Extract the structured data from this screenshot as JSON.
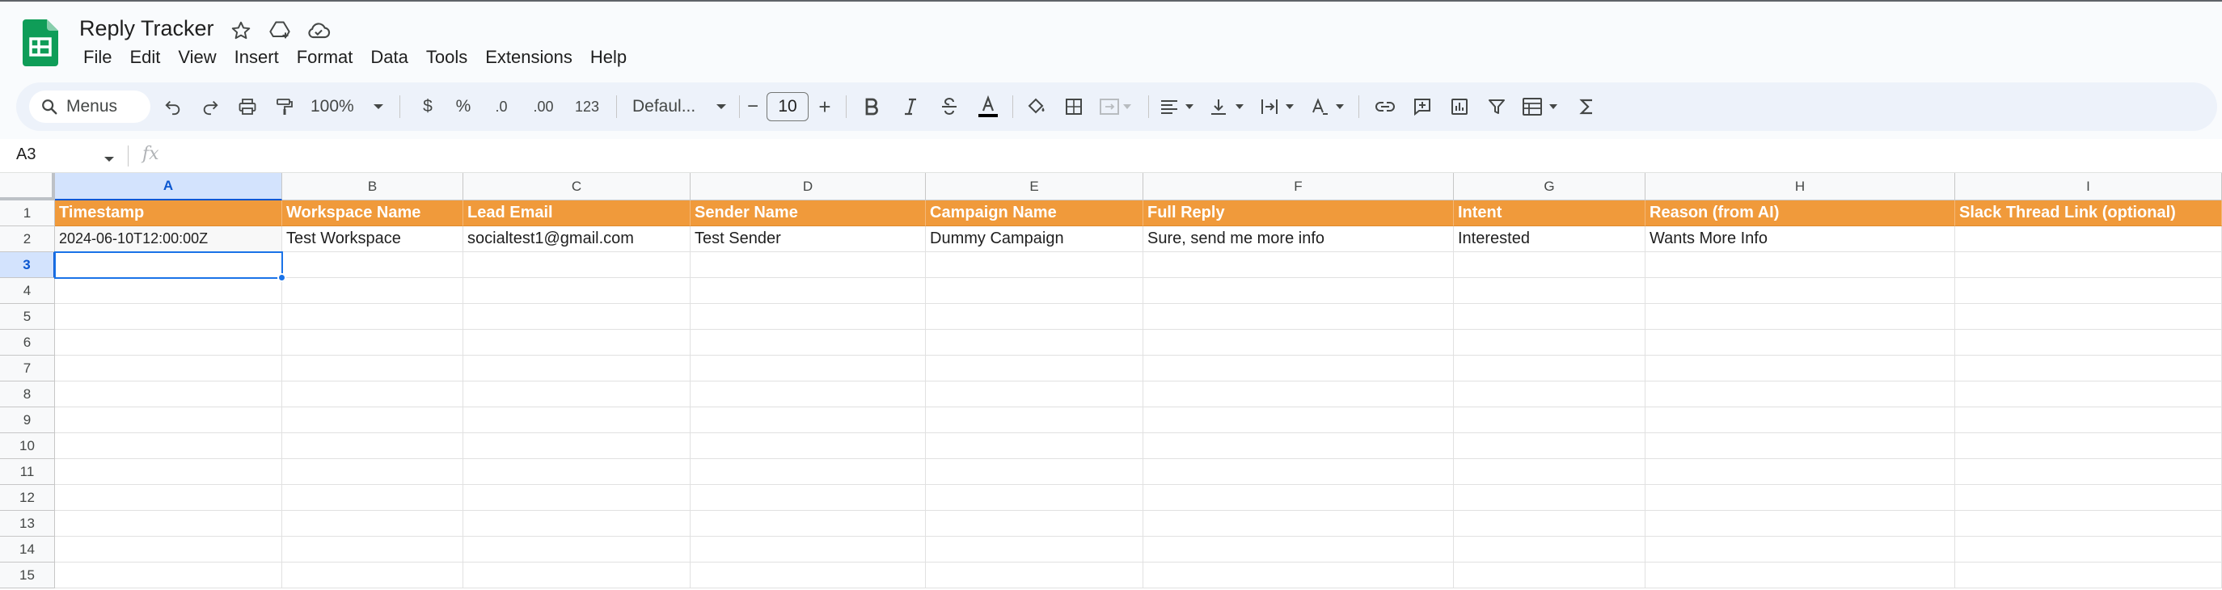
{
  "doc": {
    "title": "Reply Tracker"
  },
  "menus": [
    "File",
    "Edit",
    "View",
    "Insert",
    "Format",
    "Data",
    "Tools",
    "Extensions",
    "Help"
  ],
  "toolbar": {
    "search_label": "Menus",
    "zoom": "100%",
    "currency": "$",
    "percent": "%",
    "dec_decrease": ".0",
    "dec_increase": ".00",
    "number_format": "123",
    "font": "Defaul...",
    "font_size": "10",
    "minus": "−",
    "plus": "+"
  },
  "formula_bar": {
    "name_box": "A3",
    "fx": "fx",
    "value": ""
  },
  "grid": {
    "columns": [
      "A",
      "B",
      "C",
      "D",
      "E",
      "F",
      "G",
      "H",
      "I"
    ],
    "selected_column": "A",
    "row_numbers": [
      "1",
      "2",
      "3",
      "4",
      "5",
      "6",
      "7",
      "8",
      "9",
      "10",
      "11",
      "12",
      "13",
      "14",
      "15"
    ],
    "selected_row": "3",
    "header_row": [
      "Timestamp",
      "Workspace Name",
      "Lead Email",
      "Sender Name",
      "Campaign Name",
      "Full Reply",
      "Intent",
      "Reason (from AI)",
      "Slack Thread Link (optional)"
    ],
    "data_rows": [
      [
        "2024-06-10T12:00:00Z",
        "Test Workspace",
        "socialtest1@gmail.com",
        "Test Sender",
        "Dummy Campaign",
        "Sure, send me more info",
        "Interested",
        "Wants More Info",
        ""
      ]
    ],
    "selected_cell": "A3"
  },
  "colors": {
    "header_fill": "#f09a3b",
    "header_text": "#ffffff",
    "selection": "#1a73e8",
    "logo_green": "#0f9d58"
  }
}
